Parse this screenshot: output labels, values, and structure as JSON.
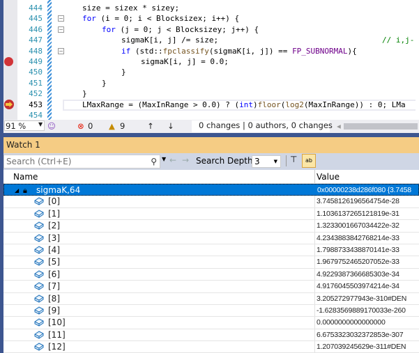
{
  "editor": {
    "lines": [
      {
        "num": "444",
        "html": "size = sizex * sizey;"
      },
      {
        "num": "445",
        "kw": "for",
        "rest": " (i = 0; i < Blocksizex; i++) {",
        "indent": 0
      },
      {
        "num": "446",
        "kw": "for",
        "rest": " (j = 0; j < Blocksizey; j++) {",
        "indent": 1
      },
      {
        "num": "447",
        "text": "sigmaK[i, j] /= size;",
        "comment": "// i,j-"
      },
      {
        "num": "448"
      },
      {
        "num": "449",
        "text": "sigmaK[i, j] = 0.0;"
      },
      {
        "num": "450",
        "text": "}"
      },
      {
        "num": "451",
        "text": "}"
      },
      {
        "num": "452",
        "text": "}"
      },
      {
        "num": "453"
      },
      {
        "num": "454"
      }
    ],
    "line448": {
      "kw": "if",
      "a": " (std::",
      "fn": "fpclassify",
      "b": "(sigmaK[i, j]) == ",
      "mac": "FP_SUBNORMAL",
      "c": "){"
    },
    "line453": {
      "a": "LMaxRange = (MaxInRange > 0.0) ? (",
      "kw": "int",
      ")": ")",
      "fn1": "floor",
      "p": "(",
      "fn2": "log2",
      "c": "(MaxInRange)) : 0; LMa"
    }
  },
  "status": {
    "zoom": "91 %",
    "errors": "0",
    "warnings": "9",
    "changes": "0 changes | 0 authors, 0 changes"
  },
  "watch": {
    "title": "Watch 1",
    "search_placeholder": "Search (Ctrl+E)",
    "search_depth_label": "Search Depth:",
    "search_depth": "3",
    "columns": {
      "name": "Name",
      "value": "Value"
    },
    "root": {
      "name": "sigmaK,64",
      "value": "0x00000238d286f080 {3.7458"
    },
    "items": [
      {
        "name": "[0]",
        "value": "3.7458126196564754e-28"
      },
      {
        "name": "[1]",
        "value": "1.1036137265121819e-31"
      },
      {
        "name": "[2]",
        "value": "1.3233001667034422e-32"
      },
      {
        "name": "[3]",
        "value": "4.2343883842768214e-33"
      },
      {
        "name": "[4]",
        "value": "1.7988733438870141e-33"
      },
      {
        "name": "[5]",
        "value": "1.9679752465207052e-33"
      },
      {
        "name": "[6]",
        "value": "4.9229387366685303e-34"
      },
      {
        "name": "[7]",
        "value": "4.9176045503974214e-34"
      },
      {
        "name": "[8]",
        "value": "3.205272977943e-310#DEN"
      },
      {
        "name": "[9]",
        "value": "-1.6283569889170033e-260"
      },
      {
        "name": "[10]",
        "value": "0.0000000000000000"
      },
      {
        "name": "[11]",
        "value": "6.6753323032372853e-307"
      },
      {
        "name": "[12]",
        "value": "1.207039245629e-311#DEN"
      }
    ]
  }
}
